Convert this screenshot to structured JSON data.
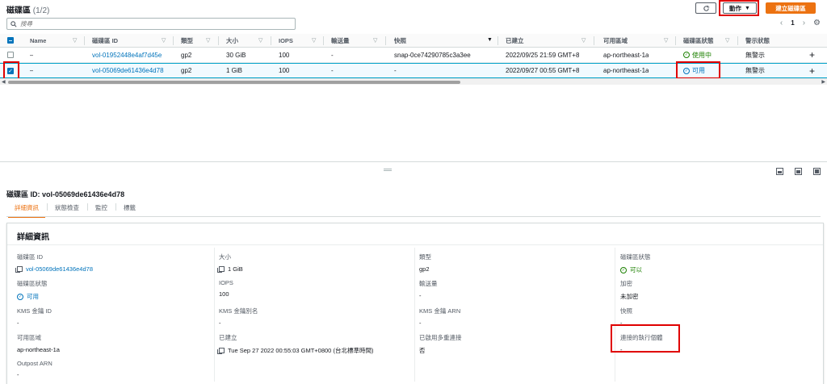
{
  "header": {
    "title": "磁碟區",
    "count": "(1/2)",
    "actions_label": "動作",
    "create_label": "建立磁碟區"
  },
  "search": {
    "placeholder": "搜尋"
  },
  "pager": {
    "page": "1"
  },
  "table": {
    "columns": [
      "Name",
      "磁碟區 ID",
      "類型",
      "大小",
      "IOPS",
      "輸送量",
      "快照",
      "已建立",
      "可用區域",
      "磁碟區狀態",
      "警示狀態"
    ],
    "rows": [
      {
        "name": "–",
        "volume_id": "vol-01952448e4af7d45e",
        "type": "gp2",
        "size": "30 GiB",
        "iops": "100",
        "throughput": "-",
        "snapshot": "snap-0ce74290785c3a3ee",
        "created": "2022/09/25 21:59 GMT+8",
        "az": "ap-northeast-1a",
        "state": "使用中",
        "alarm": "無警示",
        "selected": false
      },
      {
        "name": "–",
        "volume_id": "vol-05069de61436e4d78",
        "type": "gp2",
        "size": "1 GiB",
        "iops": "100",
        "throughput": "-",
        "snapshot": "-",
        "created": "2022/09/27 00:55 GMT+8",
        "az": "ap-northeast-1a",
        "state": "可用",
        "alarm": "無警示",
        "selected": true
      }
    ]
  },
  "detail": {
    "title": "磁碟區 ID: vol-05069de61436e4d78",
    "tabs": [
      "詳細資訊",
      "狀態檢查",
      "監控",
      "標籤"
    ],
    "section_title": "詳細資訊",
    "fields": {
      "volume_id": {
        "label": "磁碟區 ID",
        "value": "vol-05069de61436e4d78"
      },
      "size": {
        "label": "大小",
        "value": "1 GiB"
      },
      "type": {
        "label": "類型",
        "value": "gp2"
      },
      "volume_status": {
        "label": "磁碟區狀態",
        "value": "可以"
      },
      "volume_state": {
        "label": "磁碟區狀態",
        "value": "可用"
      },
      "iops": {
        "label": "IOPS",
        "value": "100"
      },
      "throughput": {
        "label": "輸送量",
        "value": "-"
      },
      "encryption": {
        "label": "加密",
        "value": "未加密"
      },
      "kms_key_id": {
        "label": "KMS 金鑰 ID",
        "value": "-"
      },
      "kms_alias": {
        "label": "KMS 金鑰別名",
        "value": "-"
      },
      "kms_arn": {
        "label": "KMS 金鑰 ARN",
        "value": "-"
      },
      "snapshot": {
        "label": "快照",
        "value": "-"
      },
      "az": {
        "label": "可用區域",
        "value": "ap-northeast-1a"
      },
      "created": {
        "label": "已建立",
        "value": "Tue Sep 27 2022 00:55:03 GMT+0800 (台北標準時間)"
      },
      "multi_attach": {
        "label": "已啟用多重連接",
        "value": "否"
      },
      "attached_instances": {
        "label": "連接的執行個體",
        "value": "-"
      },
      "outpost_arn": {
        "label": "Outpost ARN",
        "value": "-"
      }
    }
  },
  "colors": {
    "link": "#0073bb",
    "accent": "#ec7211",
    "ok": "#1d8102",
    "highlight": "#e00000"
  }
}
